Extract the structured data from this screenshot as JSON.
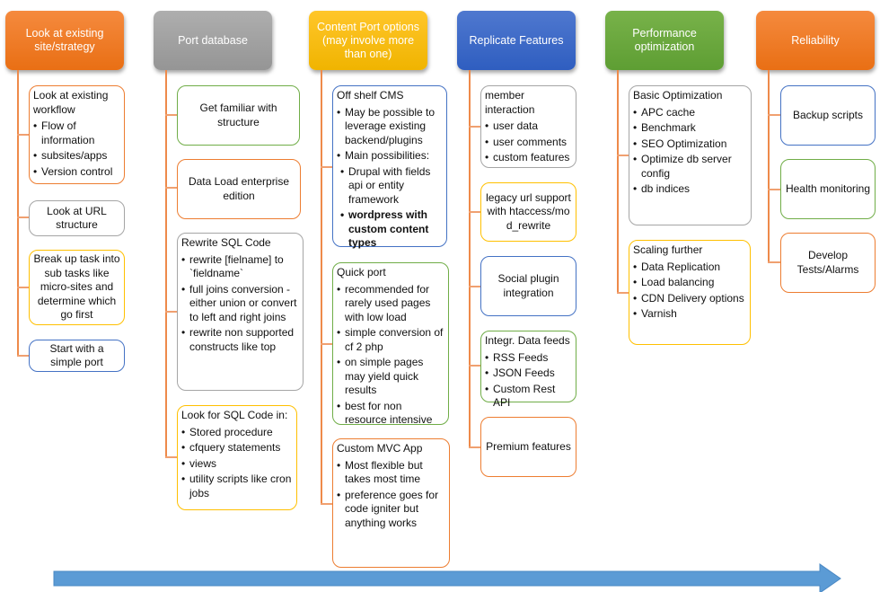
{
  "columns": [
    {
      "header": "Look at existing site/strategy",
      "color": "orange",
      "items": [
        {
          "title": "Look at existing workflow",
          "bullets": [
            "Flow of information",
            "subsites/apps",
            "Version control"
          ],
          "border": "orange"
        },
        {
          "title": "Look at URL structure",
          "border": "gray"
        },
        {
          "title": "Break up task into sub tasks like micro-sites and determine  which go first",
          "border": "yellow"
        },
        {
          "title": "Start with a simple port",
          "border": "blue"
        }
      ]
    },
    {
      "header": "Port database",
      "color": "gray",
      "items": [
        {
          "title": "Get  familiar with structure",
          "border": "green"
        },
        {
          "title": "Data Load enterprise edition",
          "border": "orange"
        },
        {
          "title": "Rewrite SQL Code",
          "bullets": [
            "rewrite [fielname] to `fieldname`",
            "full joins conversion - either union or convert to  left and right joins",
            "rewrite non supported constructs like top"
          ],
          "border": "gray"
        },
        {
          "title": "Look for SQL Code in:",
          "bullets": [
            "Stored procedure",
            "cfquery statements",
            "views",
            "utility scripts like cron jobs"
          ],
          "border": "yellow"
        }
      ]
    },
    {
      "header": "Content  Port options (may involve more than one)",
      "color": "yellow",
      "items": [
        {
          "title": "Off shelf CMS",
          "bullets": [
            "May be possible to leverage existing backend/plugins",
            "Main possibilities:"
          ],
          "sub_bullets": [
            "Drupal with fields api or entity framework",
            "wordpress with custom content types"
          ],
          "border": "blue"
        },
        {
          "title": "Quick port",
          "bullets": [
            "recommended  for rarely used pages with low load",
            "simple conversion of cf 2 php",
            "on simple pages may yield quick results",
            "best for non resource intensive"
          ],
          "border": "green"
        },
        {
          "title": "Custom MVC  App",
          "bullets": [
            "Most flexible but takes most time",
            "preference  goes for code igniter but anything works"
          ],
          "border": "orange"
        }
      ]
    },
    {
      "header": "Replicate Features",
      "color": "blue",
      "items": [
        {
          "title": "member interaction",
          "bullets": [
            "user data",
            "user comments",
            "custom features"
          ],
          "border": "gray"
        },
        {
          "title": "legacy url support with htaccess/mod_rewrite",
          "border": "yellow"
        },
        {
          "title": "Social plugin integration",
          "border": "blue"
        },
        {
          "title": "Integr. Data feeds",
          "bullets": [
            "RSS Feeds",
            "JSON Feeds",
            "Custom Rest API"
          ],
          "border": "green"
        },
        {
          "title": "Premium features",
          "border": "orange"
        }
      ]
    },
    {
      "header": "Performance optimization",
      "color": "green",
      "items": [
        {
          "title": "Basic Optimization",
          "bullets": [
            "APC cache",
            "Benchmark",
            "SEO Optimization",
            "Optimize db server config",
            "db indices"
          ],
          "border": "gray"
        },
        {
          "title": "Scaling further",
          "bullets": [
            "Data Replication",
            "Load balancing",
            "CDN  Delivery options",
            "Varnish"
          ],
          "border": "yellow"
        }
      ]
    },
    {
      "header": "Reliability",
      "color": "orange",
      "items": [
        {
          "title": "Backup scripts",
          "border": "blue"
        },
        {
          "title": "Health monitoring",
          "border": "green"
        },
        {
          "title": "Develop Tests/Alarms",
          "border": "orange"
        }
      ]
    }
  ],
  "timeline_arrow": {
    "color": "#5b9bd5",
    "direction": "right"
  }
}
